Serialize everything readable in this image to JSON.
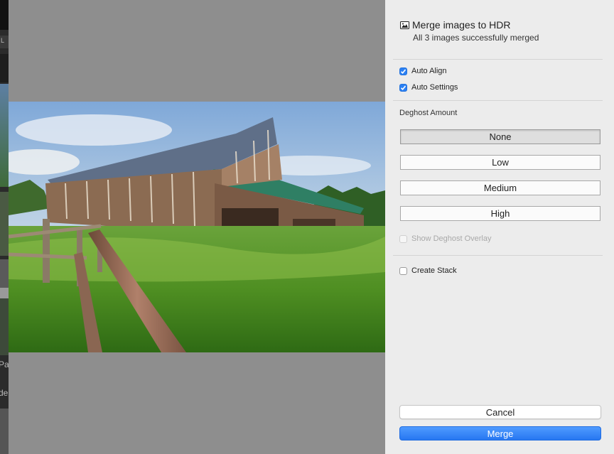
{
  "background": {
    "strip_texts": [
      "L",
      "Pa",
      "de"
    ]
  },
  "dialog": {
    "title": "Merge images to HDR",
    "subtitle": "All 3 images successfully merged",
    "title_icon": "image-icon"
  },
  "options": {
    "auto_align": {
      "label": "Auto Align",
      "checked": true
    },
    "auto_settings": {
      "label": "Auto Settings",
      "checked": true
    }
  },
  "deghost": {
    "label": "Deghost Amount",
    "options": [
      "None",
      "Low",
      "Medium",
      "High"
    ],
    "selected": "None",
    "overlay": {
      "label": "Show Deghost Overlay",
      "checked": false,
      "disabled": true
    }
  },
  "stack": {
    "label": "Create Stack",
    "checked": false
  },
  "buttons": {
    "cancel": "Cancel",
    "merge": "Merge"
  },
  "colors": {
    "accent": "#2b80f3",
    "panel_bg": "#ececec",
    "preview_bg": "#8e8e8e"
  }
}
